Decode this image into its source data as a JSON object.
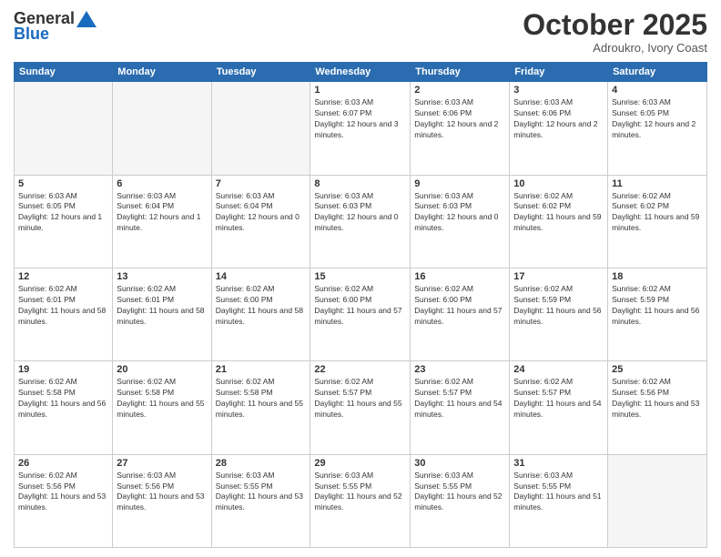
{
  "header": {
    "logo_general": "General",
    "logo_blue": "Blue",
    "month": "October 2025",
    "location": "Adroukro, Ivory Coast"
  },
  "weekdays": [
    "Sunday",
    "Monday",
    "Tuesday",
    "Wednesday",
    "Thursday",
    "Friday",
    "Saturday"
  ],
  "weeks": [
    [
      {
        "num": "",
        "info": ""
      },
      {
        "num": "",
        "info": ""
      },
      {
        "num": "",
        "info": ""
      },
      {
        "num": "1",
        "info": "Sunrise: 6:03 AM\nSunset: 6:07 PM\nDaylight: 12 hours and 3 minutes."
      },
      {
        "num": "2",
        "info": "Sunrise: 6:03 AM\nSunset: 6:06 PM\nDaylight: 12 hours and 2 minutes."
      },
      {
        "num": "3",
        "info": "Sunrise: 6:03 AM\nSunset: 6:06 PM\nDaylight: 12 hours and 2 minutes."
      },
      {
        "num": "4",
        "info": "Sunrise: 6:03 AM\nSunset: 6:05 PM\nDaylight: 12 hours and 2 minutes."
      }
    ],
    [
      {
        "num": "5",
        "info": "Sunrise: 6:03 AM\nSunset: 6:05 PM\nDaylight: 12 hours and 1 minute."
      },
      {
        "num": "6",
        "info": "Sunrise: 6:03 AM\nSunset: 6:04 PM\nDaylight: 12 hours and 1 minute."
      },
      {
        "num": "7",
        "info": "Sunrise: 6:03 AM\nSunset: 6:04 PM\nDaylight: 12 hours and 0 minutes."
      },
      {
        "num": "8",
        "info": "Sunrise: 6:03 AM\nSunset: 6:03 PM\nDaylight: 12 hours and 0 minutes."
      },
      {
        "num": "9",
        "info": "Sunrise: 6:03 AM\nSunset: 6:03 PM\nDaylight: 12 hours and 0 minutes."
      },
      {
        "num": "10",
        "info": "Sunrise: 6:02 AM\nSunset: 6:02 PM\nDaylight: 11 hours and 59 minutes."
      },
      {
        "num": "11",
        "info": "Sunrise: 6:02 AM\nSunset: 6:02 PM\nDaylight: 11 hours and 59 minutes."
      }
    ],
    [
      {
        "num": "12",
        "info": "Sunrise: 6:02 AM\nSunset: 6:01 PM\nDaylight: 11 hours and 58 minutes."
      },
      {
        "num": "13",
        "info": "Sunrise: 6:02 AM\nSunset: 6:01 PM\nDaylight: 11 hours and 58 minutes."
      },
      {
        "num": "14",
        "info": "Sunrise: 6:02 AM\nSunset: 6:00 PM\nDaylight: 11 hours and 58 minutes."
      },
      {
        "num": "15",
        "info": "Sunrise: 6:02 AM\nSunset: 6:00 PM\nDaylight: 11 hours and 57 minutes."
      },
      {
        "num": "16",
        "info": "Sunrise: 6:02 AM\nSunset: 6:00 PM\nDaylight: 11 hours and 57 minutes."
      },
      {
        "num": "17",
        "info": "Sunrise: 6:02 AM\nSunset: 5:59 PM\nDaylight: 11 hours and 56 minutes."
      },
      {
        "num": "18",
        "info": "Sunrise: 6:02 AM\nSunset: 5:59 PM\nDaylight: 11 hours and 56 minutes."
      }
    ],
    [
      {
        "num": "19",
        "info": "Sunrise: 6:02 AM\nSunset: 5:58 PM\nDaylight: 11 hours and 56 minutes."
      },
      {
        "num": "20",
        "info": "Sunrise: 6:02 AM\nSunset: 5:58 PM\nDaylight: 11 hours and 55 minutes."
      },
      {
        "num": "21",
        "info": "Sunrise: 6:02 AM\nSunset: 5:58 PM\nDaylight: 11 hours and 55 minutes."
      },
      {
        "num": "22",
        "info": "Sunrise: 6:02 AM\nSunset: 5:57 PM\nDaylight: 11 hours and 55 minutes."
      },
      {
        "num": "23",
        "info": "Sunrise: 6:02 AM\nSunset: 5:57 PM\nDaylight: 11 hours and 54 minutes."
      },
      {
        "num": "24",
        "info": "Sunrise: 6:02 AM\nSunset: 5:57 PM\nDaylight: 11 hours and 54 minutes."
      },
      {
        "num": "25",
        "info": "Sunrise: 6:02 AM\nSunset: 5:56 PM\nDaylight: 11 hours and 53 minutes."
      }
    ],
    [
      {
        "num": "26",
        "info": "Sunrise: 6:02 AM\nSunset: 5:56 PM\nDaylight: 11 hours and 53 minutes."
      },
      {
        "num": "27",
        "info": "Sunrise: 6:03 AM\nSunset: 5:56 PM\nDaylight: 11 hours and 53 minutes."
      },
      {
        "num": "28",
        "info": "Sunrise: 6:03 AM\nSunset: 5:55 PM\nDaylight: 11 hours and 53 minutes."
      },
      {
        "num": "29",
        "info": "Sunrise: 6:03 AM\nSunset: 5:55 PM\nDaylight: 11 hours and 52 minutes."
      },
      {
        "num": "30",
        "info": "Sunrise: 6:03 AM\nSunset: 5:55 PM\nDaylight: 11 hours and 52 minutes."
      },
      {
        "num": "31",
        "info": "Sunrise: 6:03 AM\nSunset: 5:55 PM\nDaylight: 11 hours and 51 minutes."
      },
      {
        "num": "",
        "info": ""
      }
    ]
  ]
}
